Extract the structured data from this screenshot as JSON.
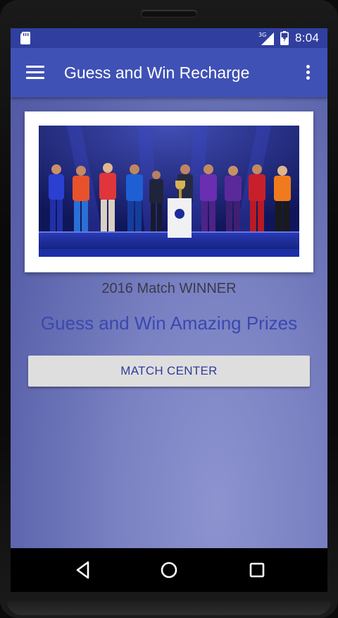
{
  "status_bar": {
    "network": "3G",
    "time": "8:04",
    "icons": [
      "sd-card-icon",
      "signal-icon",
      "battery-icon"
    ]
  },
  "app_bar": {
    "title": "Guess and Win Recharge",
    "icons": [
      "menu-icon",
      "overflow-menu-icon"
    ]
  },
  "main": {
    "banner_image": "team-captains-photo",
    "winner_label": "2016 Match WINNER",
    "tagline": "Guess and Win Amazing Prizes",
    "match_center_label": "MATCH CENTER"
  },
  "nav_bar": {
    "icons": [
      "back-icon",
      "home-icon",
      "recents-icon"
    ]
  },
  "colors": {
    "status_bar": "#303f9f",
    "app_bar": "#3f51b5",
    "background": "#6a72b8",
    "tagline": "#3a48b0",
    "button_bg": "#dedede",
    "button_text": "#2f3c9c"
  }
}
